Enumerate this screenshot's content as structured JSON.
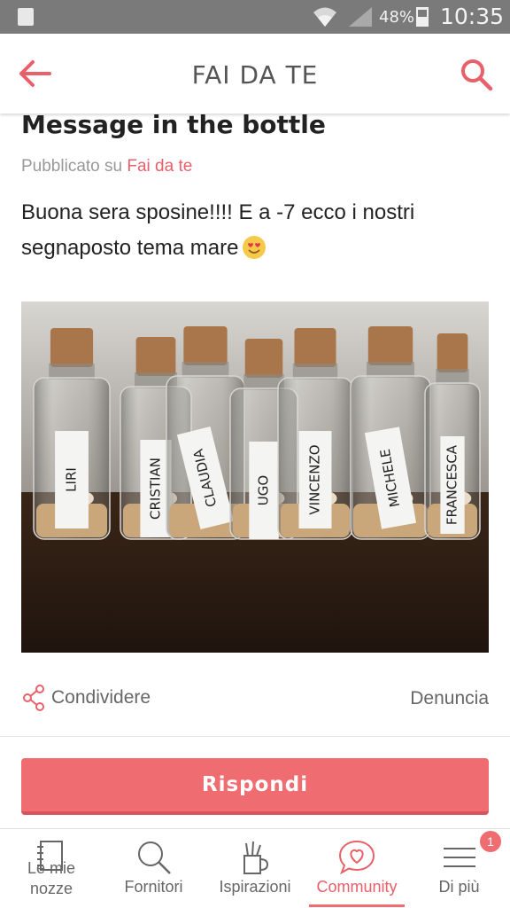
{
  "status_bar": {
    "battery_percent": "48%",
    "time": "10:35"
  },
  "header": {
    "title": "FAI DA TE"
  },
  "post": {
    "title": "Message in the bottle",
    "published_prefix": "Pubblicato su",
    "category_link": "Fai da te",
    "body_line1": "Buona sera sposine!!!! E a -7 ecco i nostri",
    "body_line2": "segnaposto tema mare",
    "emoji": "heart-eyes-emoji",
    "photo_labels": [
      "LIRI",
      "CRISTIAN",
      "CLAUDIA",
      "UGO",
      "VINCENZO",
      "MICHELE",
      "FRANCESCA"
    ]
  },
  "actions": {
    "share_label": "Condividere",
    "report_label": "Denuncia"
  },
  "reply_button": "Rispondi",
  "bottom_nav": {
    "items": [
      {
        "label_line1": "Le mie",
        "label_line2": "nozze",
        "icon": "notebook-icon"
      },
      {
        "label": "Fornitori",
        "icon": "search-icon"
      },
      {
        "label": "Ispirazioni",
        "icon": "pencil-cup-icon"
      },
      {
        "label": "Community",
        "icon": "heart-chat-icon",
        "active": true
      },
      {
        "label": "Di più",
        "icon": "menu-icon",
        "badge": "1"
      }
    ]
  },
  "colors": {
    "accent": "#ef6d70",
    "status_bar": "#7a7a7a"
  }
}
